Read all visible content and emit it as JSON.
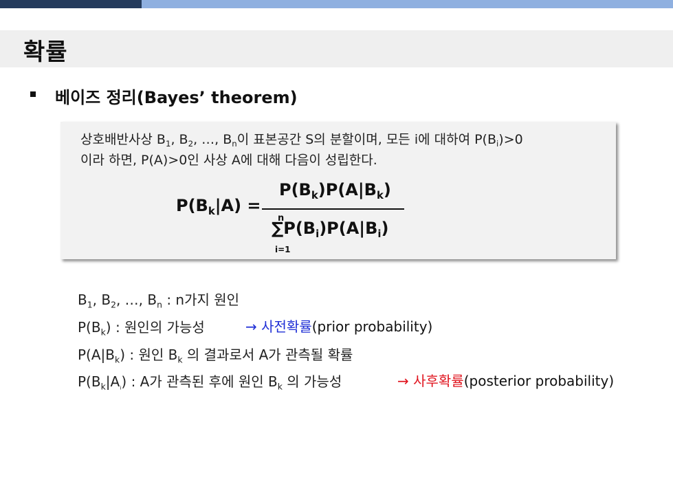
{
  "slide": {
    "title": "확률"
  },
  "section": {
    "heading": "베이즈 정리(Bayes’ theorem)"
  },
  "box": {
    "line1": {
      "prefix": "상호배반사상 B",
      "s1": "1",
      "c1": ", B",
      "s2": "2",
      "c2": ", …, B",
      "sn": "n",
      "middle": "이 표본공간 S의 분할이며, 모든 i에 대하여 P(B",
      "si": "i",
      "end": ")>0"
    },
    "line2": "이라 하면, P(A)>0인 사상 A에 대해 다음이 성립한다."
  },
  "formula": {
    "lhs": {
      "a": "P(B",
      "k": "k",
      "b": "|A) ="
    },
    "numerator": {
      "a": "P(B",
      "k1": "k",
      "b": ")P(A|B",
      "k2": "k",
      "c": ")"
    },
    "denominator": {
      "sigma": "∑",
      "a": "P(B",
      "i1": "i",
      "b": ")P(A|B",
      "i2": "i",
      "c": ")"
    },
    "sum_upper": "n",
    "sum_lower": "i=1"
  },
  "definitions": {
    "d1": {
      "a": "B",
      "s1": "1",
      "b": ", B",
      "s2": "2",
      "c": ", …, B",
      "sn": "n",
      "d": " : n가지 원인"
    },
    "d2": {
      "a": "P(B",
      "k": "k",
      "b": ") : 원인의 가능성"
    },
    "d3": {
      "a": "P(A|B",
      "k": "k",
      "b": ") : 원인 B",
      "k2": "k",
      "c": " 의 결과로서 A가 관측될 확률"
    },
    "d4": {
      "a": "P(B",
      "k": "k",
      "b": "|A",
      "s": "ᵢ",
      "c": ") : A가 관측된 후에 원인 B",
      "k2": "k",
      "d": " 의 가능성"
    }
  },
  "notes": {
    "prior": {
      "arrow": "→",
      "term": "사전확률",
      "desc": "(prior probability)"
    },
    "posterior": {
      "arrow": "→",
      "term": "사후확률",
      "desc": "(posterior probability)"
    }
  },
  "colors": {
    "header_dark": "#243b5c",
    "header_light": "#8fb0e0",
    "title_band": "#efefef",
    "box_bg": "#f2f2f2",
    "blue": "#1f2fd6",
    "red": "#e0141e"
  }
}
